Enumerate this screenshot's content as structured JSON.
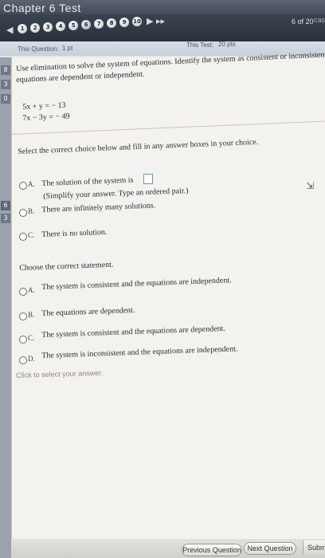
{
  "header": {
    "chapter_title": "Chapter 6 Test",
    "question_numbers": [
      "1",
      "2",
      "3",
      "4",
      "5",
      "6",
      "7",
      "8",
      "9",
      "10"
    ],
    "prev_arrow": "◀",
    "next_arrows": "▶ ▸▸",
    "count": "6 of 20",
    "count_suffix": "cas"
  },
  "score": {
    "question_label": "This Question:",
    "question_points": "1 pt",
    "test_label": "This Test:",
    "test_points": "20 pts"
  },
  "question": {
    "instruction_line1": "Use elimination to solve the system of equations. Identify the system as consistent or inconsistent. If the system is consistent, state whether the",
    "instruction_line2": "equations are dependent or independent.",
    "equation1": "5x + y = − 13",
    "equation2": "7x − 3y = − 49"
  },
  "part1": {
    "prompt": "Select the correct choice below and fill in any answer boxes in your choice.",
    "options": [
      {
        "letter": "A.",
        "text": "The solution of the system is",
        "subtext": "(Simplify your answer. Type an ordered pair.)"
      },
      {
        "letter": "B.",
        "text": "There are infinitely many solutions."
      },
      {
        "letter": "C.",
        "text": "There is no solution."
      }
    ]
  },
  "part2": {
    "prompt": "Choose the correct statement.",
    "options": [
      {
        "letter": "A.",
        "text": "The system is consistent and the equations are independent."
      },
      {
        "letter": "B.",
        "text": "The equations are dependent."
      },
      {
        "letter": "C.",
        "text": "The system is consistent and the equations are dependent."
      },
      {
        "letter": "D.",
        "text": "The system is inconsistent and the equations are independent."
      }
    ]
  },
  "footer": {
    "hint": "Click to select your answer.",
    "prev_button": "Previous Question",
    "next_button": "Next Question",
    "submit_button": "Subm"
  },
  "rail": {
    "tabs": [
      "8",
      "3",
      "0",
      "6",
      "3"
    ]
  }
}
